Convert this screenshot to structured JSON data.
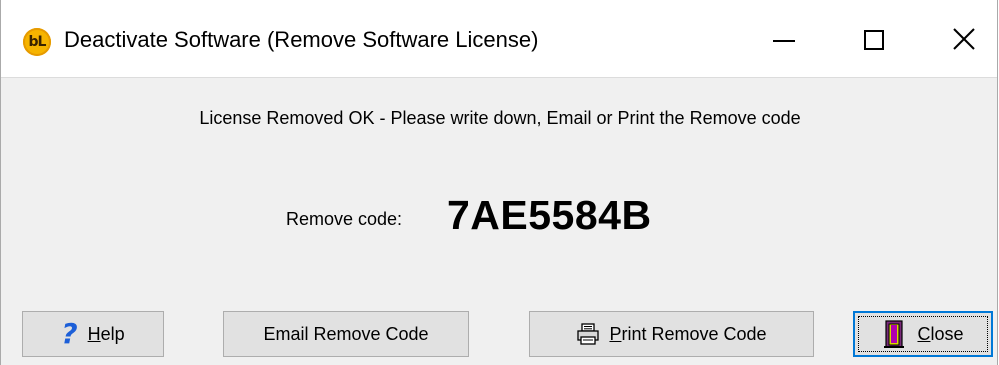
{
  "window": {
    "title": "Deactivate Software (Remove Software License)",
    "icon_text": "bL",
    "controls": {
      "minimize": "minimize-icon",
      "maximize": "maximize-icon",
      "close": "close-icon"
    }
  },
  "content": {
    "status_message": "License Removed OK - Please write down, Email or Print the Remove code",
    "remove_code_label": "Remove code:",
    "remove_code_value": "7AE5584B"
  },
  "buttons": {
    "help": {
      "mnemonic": "H",
      "rest": "elp",
      "icon": "question-icon"
    },
    "email": {
      "label": "Email Remove Code"
    },
    "print": {
      "mnemonic": "P",
      "rest": "rint Remove Code",
      "icon": "printer-icon"
    },
    "close": {
      "mnemonic": "C",
      "rest": "lose",
      "icon": "door-exit-icon"
    }
  },
  "colors": {
    "app_icon": "#f6b400",
    "focus_border": "#0078d7",
    "help_icon": "#1c5fd8",
    "close_icon_purple": "#b000b0"
  }
}
